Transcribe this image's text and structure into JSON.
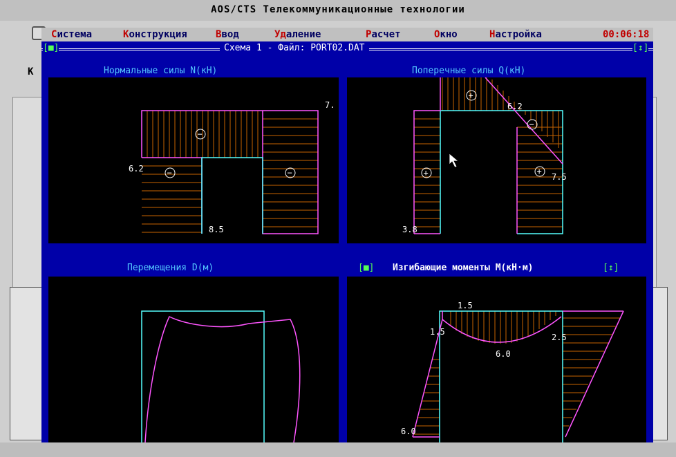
{
  "app": {
    "title": "AOS/CTS Телекоммуникационные технологии"
  },
  "menu": {
    "items": [
      {
        "hl": "С",
        "rest": "истема"
      },
      {
        "hl": "К",
        "rest": "онструкция"
      },
      {
        "hl": "В",
        "rest": "вод"
      },
      {
        "hl": "Уд",
        "rest": "аление"
      },
      {
        "hl": "Р",
        "rest": "асчет"
      },
      {
        "hl": "О",
        "rest": "кно"
      },
      {
        "hl": "Н",
        "rest": "астройка"
      }
    ],
    "clock": "00:06:18"
  },
  "window": {
    "title": "Схема  1 - Файл: PORT02.DAT",
    "left_marker": "[■]",
    "right_marker": "[↕]"
  },
  "panels": {
    "normal": {
      "title": "Нормальные силы  N(кН)"
    },
    "shear": {
      "title": "Поперечные силы  Q(кН)"
    },
    "displacement": {
      "title": "Перемещения  D(м)"
    },
    "moment": {
      "title": "Изгибающие моменты M(кН·м)",
      "left_marker": "[■]",
      "right_marker": "[↕]"
    }
  },
  "labels": {
    "n_top_right": "7.",
    "n_left": "6.2",
    "n_bottom": "8.5",
    "q_top": "6.2",
    "q_right": "7.5",
    "q_bottom_left": "3.8",
    "m_top": "1.5",
    "m_left": "1.5",
    "m_right": "2.5",
    "m_mid": "6.0",
    "m_bottom_left": "6.0"
  },
  "signs": {
    "minus": "−",
    "plus": "+"
  },
  "colors": {
    "dos_blue": "#0000a8",
    "frame_cyan": "#55ffff",
    "diagram_magenta": "#ff55ff",
    "hatch_orange": "#c86400",
    "menu_hotkey": "#c00000"
  },
  "left_stub": "K",
  "icons": {
    "cursor": "mouse-pointer-icon"
  }
}
